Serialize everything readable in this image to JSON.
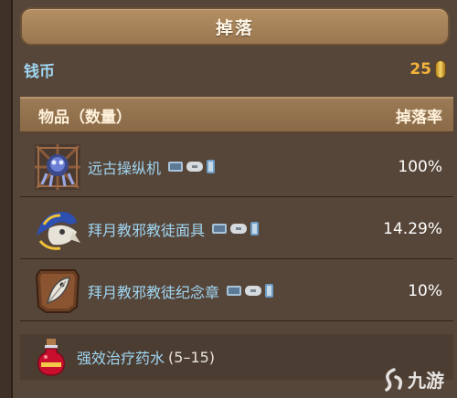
{
  "title": "掉落",
  "coins": {
    "label": "钱币",
    "value": "25",
    "icon": "gold-coin-icon"
  },
  "table": {
    "col_item": "物品（数量）",
    "col_rate": "掉落率"
  },
  "rows": [
    {
      "name": "远古操纵机",
      "rate": "100%",
      "icon": "ancient-manipulator-icon",
      "platforms": [
        "pc-icon",
        "console-icon",
        "mobile-icon"
      ]
    },
    {
      "name": "拜月教邪教徒面具",
      "rate": "14.29%",
      "icon": "cultist-mask-icon",
      "platforms": [
        "pc-icon",
        "console-icon",
        "mobile-icon"
      ]
    },
    {
      "name": "拜月教邪教徒纪念章",
      "rate": "10%",
      "icon": "cultist-trophy-icon",
      "platforms": [
        "pc-icon",
        "console-icon",
        "mobile-icon"
      ]
    }
  ],
  "partial_row": {
    "name": "强效治疗药水",
    "qty": "(5–15)",
    "icon": "greater-healing-potion-icon"
  },
  "watermark": {
    "text": "九游",
    "icon": "jiuyou-logo-icon"
  },
  "colors": {
    "link": "#9fd6f2",
    "coin": "#f2b43c",
    "header": "#9b7a55"
  }
}
